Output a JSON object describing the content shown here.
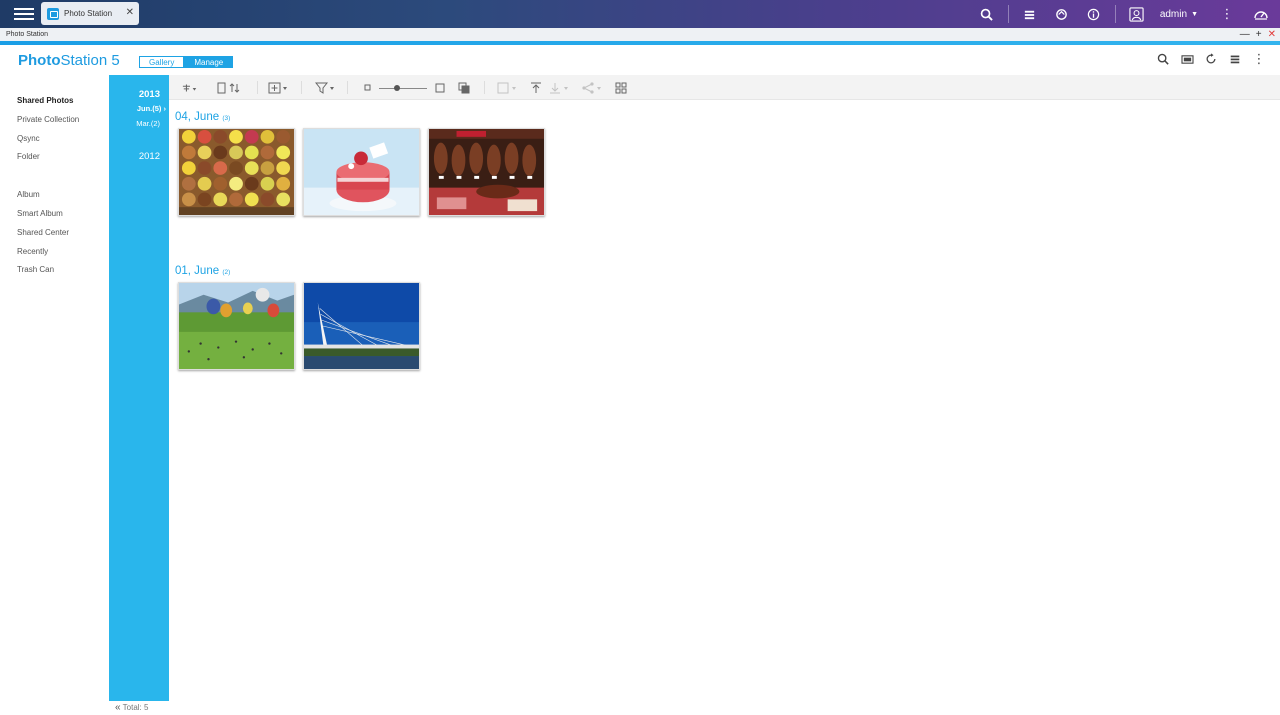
{
  "taskbar": {
    "app_tab_label": "Photo Station",
    "user_name": "admin"
  },
  "window": {
    "title": "Photo Station"
  },
  "header": {
    "logo_bold": "Photo",
    "logo_rest": "Station 5",
    "modes": [
      "Gallery",
      "Manage"
    ],
    "active_mode": "Manage"
  },
  "sidebar": {
    "items": [
      "Shared Photos",
      "Private Collection",
      "Qsync",
      "Folder"
    ],
    "items2": [
      "Album",
      "Smart Album",
      "Shared Center",
      "Recently",
      "Trash Can"
    ],
    "active": "Shared Photos"
  },
  "timeline": {
    "year1": "2013",
    "month1": "Jun.(5) ›",
    "month2": "Mar.(2)",
    "year2": "2012"
  },
  "groups": [
    {
      "title": "04, June",
      "count": "(3)",
      "photos": [
        "macarons-photo",
        "pink-macaron-cake-photo",
        "ham-shop-photo"
      ]
    },
    {
      "title": "01, June",
      "count": "(2)",
      "photos": [
        "hot-air-balloons-photo",
        "bridge-photo"
      ]
    }
  ],
  "footer": {
    "total": "Total: 5"
  },
  "colors": {
    "accent": "#1ea3e4",
    "timeline": "#29b6ec"
  }
}
